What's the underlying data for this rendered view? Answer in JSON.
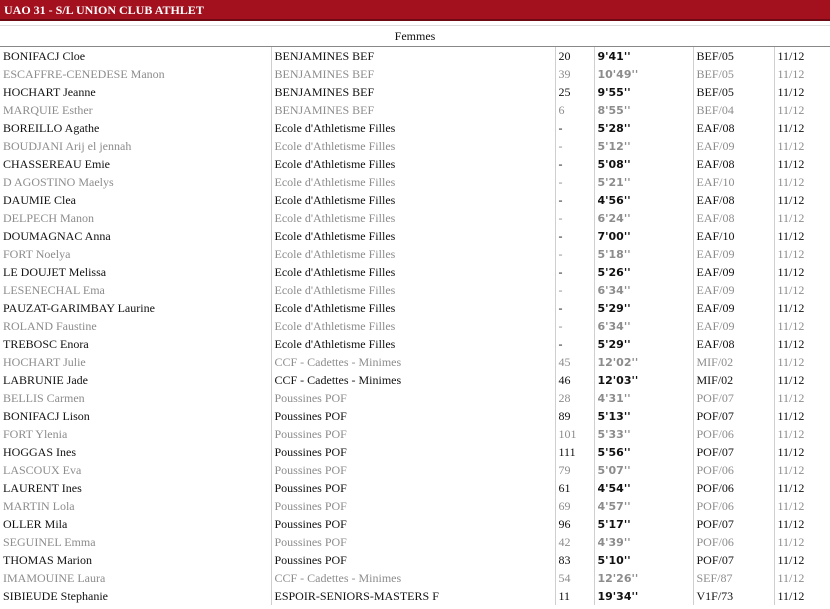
{
  "header": {
    "title": "UAO 31 - S/L UNION CLUB ATHLET"
  },
  "section": {
    "title": "Femmes"
  },
  "rows": [
    {
      "name": "BONIFACJ Cloe",
      "cat": "BENJAMINES BEF",
      "dos": "20",
      "perf": "9'41''",
      "cls": "BEF/05",
      "date": "11/12"
    },
    {
      "name": "ESCAFFRE-CENEDESE Manon",
      "cat": "BENJAMINES BEF",
      "dos": "39",
      "perf": "10'49''",
      "cls": "BEF/05",
      "date": "11/12"
    },
    {
      "name": "HOCHART Jeanne",
      "cat": "BENJAMINES BEF",
      "dos": "25",
      "perf": "9'55''",
      "cls": "BEF/05",
      "date": "11/12"
    },
    {
      "name": "MARQUIE Esther",
      "cat": "BENJAMINES BEF",
      "dos": "6",
      "perf": "8'55''",
      "cls": "BEF/04",
      "date": "11/12"
    },
    {
      "name": "BOREILLO Agathe",
      "cat": "Ecole d'Athletisme Filles",
      "dos": "-",
      "perf": "5'28''",
      "cls": "EAF/08",
      "date": "11/12"
    },
    {
      "name": "BOUDJANI Arij el jennah",
      "cat": "Ecole d'Athletisme Filles",
      "dos": "-",
      "perf": "5'12''",
      "cls": "EAF/09",
      "date": "11/12"
    },
    {
      "name": "CHASSEREAU Emie",
      "cat": "Ecole d'Athletisme Filles",
      "dos": "-",
      "perf": "5'08''",
      "cls": "EAF/08",
      "date": "11/12"
    },
    {
      "name": "D AGOSTINO Maelys",
      "cat": "Ecole d'Athletisme Filles",
      "dos": "-",
      "perf": "5'21''",
      "cls": "EAF/10",
      "date": "11/12"
    },
    {
      "name": "DAUMIE Clea",
      "cat": "Ecole d'Athletisme Filles",
      "dos": "-",
      "perf": "4'56''",
      "cls": "EAF/08",
      "date": "11/12"
    },
    {
      "name": "DELPECH Manon",
      "cat": "Ecole d'Athletisme Filles",
      "dos": "-",
      "perf": "6'24''",
      "cls": "EAF/08",
      "date": "11/12"
    },
    {
      "name": "DOUMAGNAC Anna",
      "cat": "Ecole d'Athletisme Filles",
      "dos": "-",
      "perf": "7'00''",
      "cls": "EAF/10",
      "date": "11/12"
    },
    {
      "name": "FORT Noelya",
      "cat": "Ecole d'Athletisme Filles",
      "dos": "-",
      "perf": "5'18''",
      "cls": "EAF/09",
      "date": "11/12"
    },
    {
      "name": "LE DOUJET Melissa",
      "cat": "Ecole d'Athletisme Filles",
      "dos": "-",
      "perf": "5'26''",
      "cls": "EAF/09",
      "date": "11/12"
    },
    {
      "name": "LESENECHAL Ema",
      "cat": "Ecole d'Athletisme Filles",
      "dos": "-",
      "perf": "6'34''",
      "cls": "EAF/09",
      "date": "11/12"
    },
    {
      "name": "PAUZAT-GARIMBAY Laurine",
      "cat": "Ecole d'Athletisme Filles",
      "dos": "-",
      "perf": "5'29''",
      "cls": "EAF/09",
      "date": "11/12"
    },
    {
      "name": "ROLAND Faustine",
      "cat": "Ecole d'Athletisme Filles",
      "dos": "-",
      "perf": "6'34''",
      "cls": "EAF/09",
      "date": "11/12"
    },
    {
      "name": "TREBOSC Enora",
      "cat": "Ecole d'Athletisme Filles",
      "dos": "-",
      "perf": "5'29''",
      "cls": "EAF/08",
      "date": "11/12"
    },
    {
      "name": "HOCHART Julie",
      "cat": "CCF - Cadettes - Minimes",
      "dos": "45",
      "perf": "12'02''",
      "cls": "MIF/02",
      "date": "11/12"
    },
    {
      "name": "LABRUNIE Jade",
      "cat": "CCF - Cadettes - Minimes",
      "dos": "46",
      "perf": "12'03''",
      "cls": "MIF/02",
      "date": "11/12"
    },
    {
      "name": "BELLIS Carmen",
      "cat": "Poussines POF",
      "dos": "28",
      "perf": "4'31''",
      "cls": "POF/07",
      "date": "11/12"
    },
    {
      "name": "BONIFACJ Lison",
      "cat": "Poussines POF",
      "dos": "89",
      "perf": "5'13''",
      "cls": "POF/07",
      "date": "11/12"
    },
    {
      "name": "FORT Ylenia",
      "cat": "Poussines POF",
      "dos": "101",
      "perf": "5'33''",
      "cls": "POF/06",
      "date": "11/12"
    },
    {
      "name": "HOGGAS Ines",
      "cat": "Poussines POF",
      "dos": "111",
      "perf": "5'56''",
      "cls": "POF/07",
      "date": "11/12"
    },
    {
      "name": "LASCOUX Eva",
      "cat": "Poussines POF",
      "dos": "79",
      "perf": "5'07''",
      "cls": "POF/06",
      "date": "11/12"
    },
    {
      "name": "LAURENT Ines",
      "cat": "Poussines POF",
      "dos": "61",
      "perf": "4'54''",
      "cls": "POF/06",
      "date": "11/12"
    },
    {
      "name": "MARTIN Lola",
      "cat": "Poussines POF",
      "dos": "69",
      "perf": "4'57''",
      "cls": "POF/06",
      "date": "11/12"
    },
    {
      "name": "OLLER Mila",
      "cat": "Poussines POF",
      "dos": "96",
      "perf": "5'17''",
      "cls": "POF/07",
      "date": "11/12"
    },
    {
      "name": "SEGUINEL Emma",
      "cat": "Poussines POF",
      "dos": "42",
      "perf": "4'39''",
      "cls": "POF/06",
      "date": "11/12"
    },
    {
      "name": "THOMAS Marion",
      "cat": "Poussines POF",
      "dos": "83",
      "perf": "5'10''",
      "cls": "POF/07",
      "date": "11/12"
    },
    {
      "name": "IMAMOUINE Laura",
      "cat": "CCF - Cadettes - Minimes",
      "dos": "54",
      "perf": "12'26''",
      "cls": "SEF/87",
      "date": "11/12"
    },
    {
      "name": "SIBIEUDE Stephanie",
      "cat": "ESPOIR-SENIORS-MASTERS F",
      "dos": "11",
      "perf": "19'34''",
      "cls": "V1F/73",
      "date": "11/12"
    }
  ]
}
